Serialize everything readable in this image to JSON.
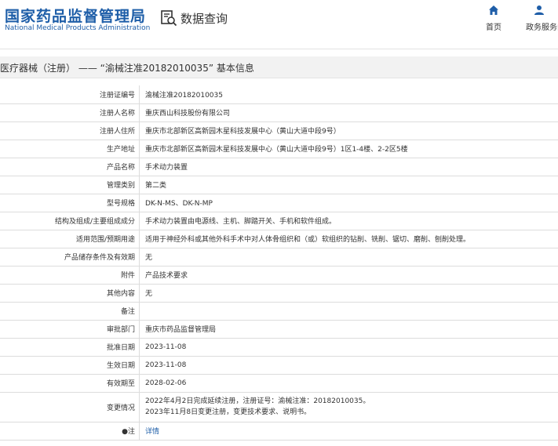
{
  "header": {
    "logo_cn": "国家药品监督管理局",
    "logo_en": "National Medical Products Administration",
    "query_label": "数据查询",
    "nav": [
      {
        "label": "首页",
        "icon": "home-icon"
      },
      {
        "label": "政务服务门",
        "icon": "user-icon"
      }
    ]
  },
  "title": "医疗器械（注册） —— “渝械注准20182010035” 基本信息",
  "rows": [
    {
      "label": "注册证编号",
      "value": "渝械注准20182010035"
    },
    {
      "label": "注册人名称",
      "value": "重庆西山科技股份有限公司"
    },
    {
      "label": "注册人住所",
      "value": "重庆市北部新区高新园木星科技发展中心（黄山大道中段9号）"
    },
    {
      "label": "生产地址",
      "value": "重庆市北部新区高新园木星科技发展中心（黄山大道中段9号）1区1-4楼、2-2区5楼"
    },
    {
      "label": "产品名称",
      "value": "手术动力装置"
    },
    {
      "label": "管理类别",
      "value": "第二类"
    },
    {
      "label": "型号规格",
      "value": "DK-N-MS、DK-N-MP"
    },
    {
      "label": "结构及组成/主要组成成分",
      "value": "手术动力装置由电源线、主机、脚踏开关、手机和软件组成。"
    },
    {
      "label": "适用范围/预期用途",
      "value": "适用于神经外科或其他外科手术中对人体骨组织和（或）软组织的钻削、铣削、锯切、磨削、刨削处理。"
    },
    {
      "label": "产品储存条件及有效期",
      "value": "无"
    },
    {
      "label": "附件",
      "value": "产品技术要求"
    },
    {
      "label": "其他内容",
      "value": "无"
    },
    {
      "label": "备注",
      "value": ""
    },
    {
      "label": "审批部门",
      "value": "重庆市药品监督管理局"
    },
    {
      "label": "批准日期",
      "value": "2023-11-08"
    },
    {
      "label": "生效日期",
      "value": "2023-11-08"
    },
    {
      "label": "有效期至",
      "value": "2028-02-06"
    }
  ],
  "change_row": {
    "label": "变更情况",
    "line1": "2022年4月2日完成延续注册，注册证号：渝械注准：20182010035。",
    "line2": "2023年11月8日变更注册，变更技术要求、说明书。"
  },
  "note_row": {
    "label": "注",
    "link": "详情"
  }
}
